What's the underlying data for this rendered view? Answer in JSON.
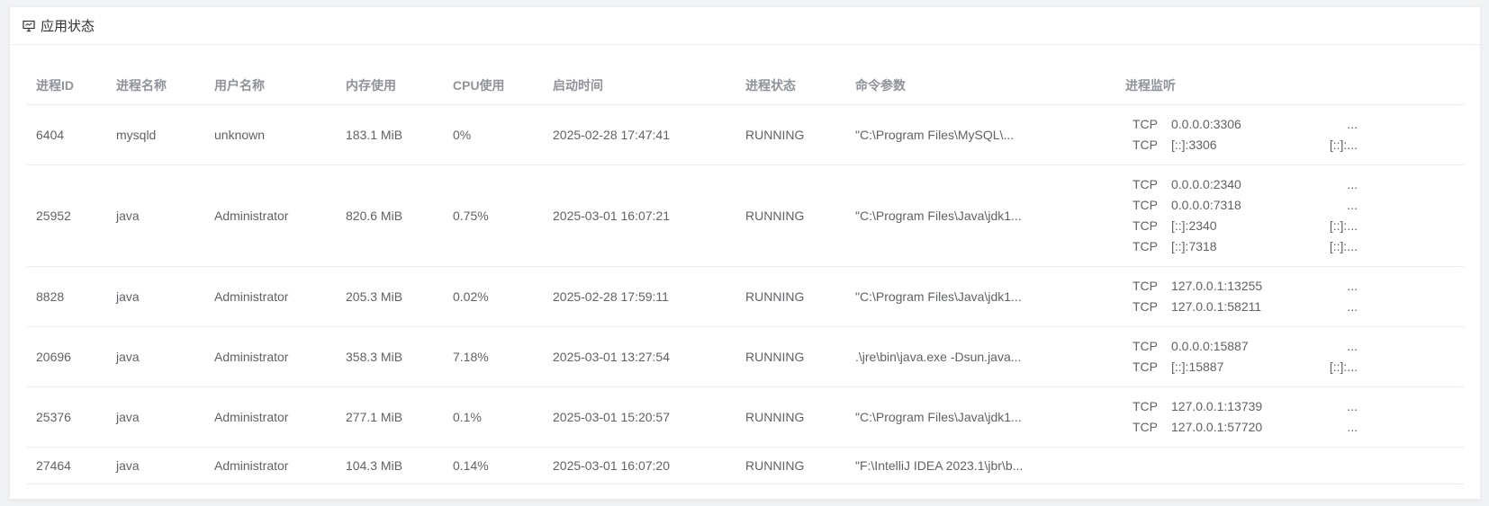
{
  "panel": {
    "title": "应用状态",
    "icon": "monitor-icon"
  },
  "columns": [
    "进程ID",
    "进程名称",
    "用户名称",
    "内存使用",
    "CPU使用",
    "启动时间",
    "进程状态",
    "命令参数",
    "进程监听"
  ],
  "rows": [
    {
      "pid": "6404",
      "name": "mysqld",
      "user": "unknown",
      "mem": "183.1 MiB",
      "cpu": "0%",
      "start": "2025-02-28 17:47:41",
      "status": "RUNNING",
      "cmd": "\"C:\\Program Files\\MySQL\\...",
      "listen": [
        {
          "proto": "TCP",
          "local": "0.0.0.0:3306",
          "rest": "..."
        },
        {
          "proto": "TCP",
          "local": "[::]:3306",
          "rest": "[::]:..."
        }
      ]
    },
    {
      "pid": "25952",
      "name": "java",
      "user": "Administrator",
      "mem": "820.6 MiB",
      "cpu": "0.75%",
      "start": "2025-03-01 16:07:21",
      "status": "RUNNING",
      "cmd": "\"C:\\Program Files\\Java\\jdk1...",
      "listen": [
        {
          "proto": "TCP",
          "local": "0.0.0.0:2340",
          "rest": "..."
        },
        {
          "proto": "TCP",
          "local": "0.0.0.0:7318",
          "rest": "..."
        },
        {
          "proto": "TCP",
          "local": "[::]:2340",
          "rest": "[::]:..."
        },
        {
          "proto": "TCP",
          "local": "[::]:7318",
          "rest": "[::]:..."
        }
      ]
    },
    {
      "pid": "8828",
      "name": "java",
      "user": "Administrator",
      "mem": "205.3 MiB",
      "cpu": "0.02%",
      "start": "2025-02-28 17:59:11",
      "status": "RUNNING",
      "cmd": "\"C:\\Program Files\\Java\\jdk1...",
      "listen": [
        {
          "proto": "TCP",
          "local": "127.0.0.1:13255",
          "rest": "..."
        },
        {
          "proto": "TCP",
          "local": "127.0.0.1:58211",
          "rest": "..."
        }
      ]
    },
    {
      "pid": "20696",
      "name": "java",
      "user": "Administrator",
      "mem": "358.3 MiB",
      "cpu": "7.18%",
      "start": "2025-03-01 13:27:54",
      "status": "RUNNING",
      "cmd": ".\\jre\\bin\\java.exe -Dsun.java...",
      "listen": [
        {
          "proto": "TCP",
          "local": "0.0.0.0:15887",
          "rest": "..."
        },
        {
          "proto": "TCP",
          "local": "[::]:15887",
          "rest": "[::]:..."
        }
      ]
    },
    {
      "pid": "25376",
      "name": "java",
      "user": "Administrator",
      "mem": "277.1 MiB",
      "cpu": "0.1%",
      "start": "2025-03-01 15:20:57",
      "status": "RUNNING",
      "cmd": "\"C:\\Program Files\\Java\\jdk1...",
      "listen": [
        {
          "proto": "TCP",
          "local": "127.0.0.1:13739",
          "rest": "..."
        },
        {
          "proto": "TCP",
          "local": "127.0.0.1:57720",
          "rest": "..."
        }
      ]
    },
    {
      "pid": "27464",
      "name": "java",
      "user": "Administrator",
      "mem": "104.3 MiB",
      "cpu": "0.14%",
      "start": "2025-03-01 16:07:20",
      "status": "RUNNING",
      "cmd": "\"F:\\IntelliJ IDEA 2023.1\\jbr\\b...",
      "listen": []
    }
  ]
}
